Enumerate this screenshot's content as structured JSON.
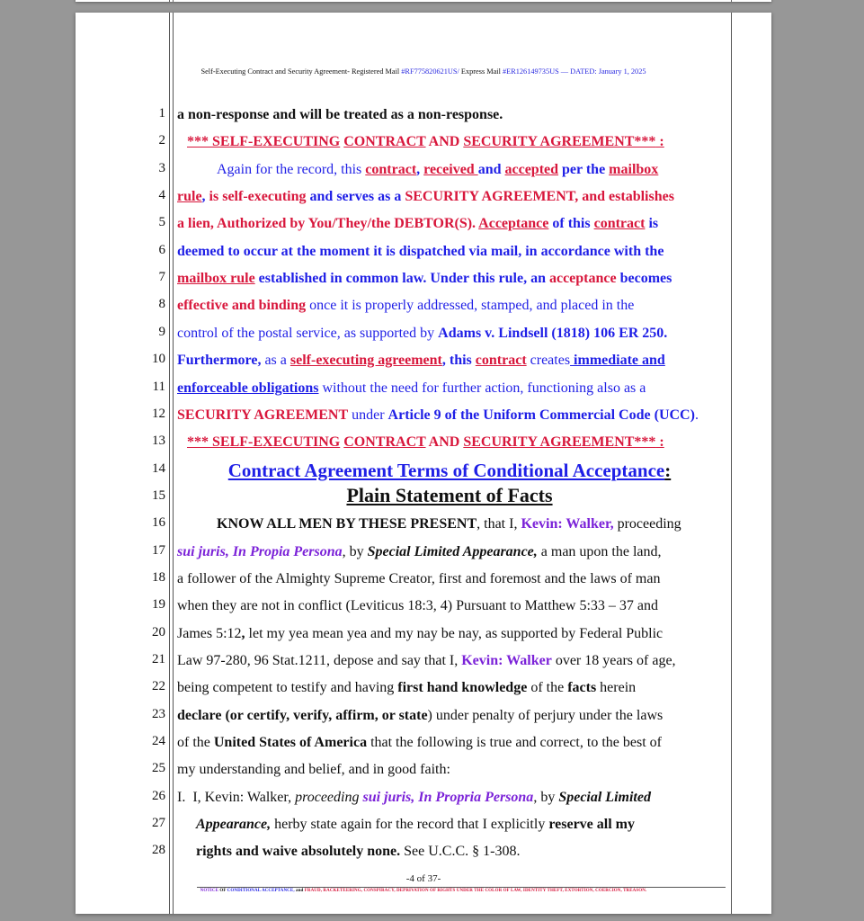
{
  "header": {
    "prefix": "Self-Executing Contract and Security Agreement- Registered Mail ",
    "registered_no": "#RF775820621US/",
    "express_label": " Express Mail ",
    "express_no": "#ER126149735US",
    "dated": "  — DATED: January 1, 2025"
  },
  "lines": {
    "l1": "a non-response and will be treated as a non-response.",
    "l2": {
      "a": "*** SELF-EXECUTING",
      "b": " ",
      "c": "CONTRACT",
      "d": " AND ",
      "e": "SECURITY AGREEMENT***",
      "f": " :"
    },
    "l3": {
      "a": "Again for the record, this ",
      "b": "contract",
      "c": ", ",
      "d": "received ",
      "e": "and ",
      "f": "accepted",
      "g": " per the ",
      "h": "mailbox"
    },
    "l4": {
      "a": "rule",
      "b": ", ",
      "c": "is self-executing",
      "d": " and serves as a ",
      "e": "SECURITY AGREEMENT, and establishes"
    },
    "l5": {
      "a": "a lien, Authorized by You/They/the DEBTOR(S). ",
      "b": "Acceptance",
      "c": " of this ",
      "d": "contract",
      "e": " is"
    },
    "l6": "deemed to occur at the moment it is dispatched via mail, in accordance with the",
    "l7": {
      "a": "mailbox rule",
      "b": " established in common law. Under this rule, an ",
      "c": "acceptance",
      "d": " becomes"
    },
    "l8": {
      "a": "effective and binding",
      "b": " once it is properly addressed, stamped, and placed in the"
    },
    "l9": {
      "a": "control of the postal service, as supported by ",
      "b": "Adams v. Lindsell (1818) 106 ER 250."
    },
    "l10": {
      "a": "Furthermore,",
      "b": " as a ",
      "c": "self-executing agreement",
      "d": ", this ",
      "e": "contract",
      "f": " creates",
      "g": " immediate and"
    },
    "l11": {
      "a": "enforceable obligations",
      "b": " without the need for further action, functioning also as a"
    },
    "l12": {
      "a": "SECURITY AGREEMENT",
      "b": " under ",
      "c": "Article 9 of the Uniform Commercial Code (UCC)",
      "d": "."
    },
    "l13": {
      "a": "*** SELF-EXECUTING",
      "b": " ",
      "c": "CONTRACT",
      "d": " AND ",
      "e": "SECURITY AGREEMENT***",
      "f": " :"
    },
    "l14": {
      "a": "Contract Agreement Terms of Conditional Acceptance",
      "b": ":"
    },
    "l15": "Plain Statement of Facts",
    "l16": {
      "a": "KNOW ALL MEN BY THESE PRESENT",
      "b": ", that I, ",
      "c": "Kevin: Walker,",
      "d": " proceeding"
    },
    "l17": {
      "a": "sui juris, In Propia Persona",
      "b": ", by ",
      "c": "Special Limited Appearance,",
      "d": " a man upon the land,"
    },
    "l18": "a follower of the Almighty Supreme Creator, first and foremost and the laws of man",
    "l19": "when they are not in conflict (Leviticus 18:3, 4) Pursuant to Matthew 5:33 – 37 and",
    "l20": {
      "a": "James 5:12",
      "b": ",",
      "c": " let my yea mean yea and my nay be nay, as supported by Federal Public"
    },
    "l21": {
      "a": "Law 97-280, 96 Stat.1211, depose and say that I, ",
      "b": "Kevin: Walker",
      "c": " over 18 years of age,"
    },
    "l22": {
      "a": "being competent to testify and having ",
      "b": "first hand knowledge",
      "c": " of the ",
      "d": "facts",
      "e": " herein"
    },
    "l23": {
      "a": "declare (or certify, verify, affirm, or state",
      "b": ") under penalty of perjury under the laws"
    },
    "l24": {
      "a": "of the ",
      "b": "United States of America",
      "c": " that the following is true and correct, to the best of"
    },
    "l25": "my understanding and belief, and in good faith:",
    "l26": {
      "num": "I.",
      "a": "I, Kevin: Walker, ",
      "b": "proceeding",
      "c": " ",
      "d": "sui juris, In Propria Persona",
      "e": ", by ",
      "f": "Special Limited"
    },
    "l27": {
      "a": "Appearance,",
      "b": " herby state again for the record that I explicitly ",
      "c": "reserve all my"
    },
    "l28": {
      "a": "rights and waive absolutely none.",
      "b": " See U.C.C. § 1-308."
    }
  },
  "line_numbers": [
    "1",
    "2",
    "3",
    "4",
    "5",
    "6",
    "7",
    "8",
    "9",
    "10",
    "11",
    "12",
    "13",
    "14",
    "15",
    "16",
    "17",
    "18",
    "19",
    "20",
    "21",
    "22",
    "23",
    "24",
    "25",
    "26",
    "27",
    "28"
  ],
  "footer": {
    "page": "-4 of 37-",
    "notice_a": "NOTICE",
    "notice_b": " OF ",
    "notice_c": "CONDITIONAL ACCEPTANCE,",
    "notice_d": " and ",
    "notice_e": "FRAUD, RACKETEERING, CONSPIRACY, DEPRIVATION OF RIGHTS UNDER THE COLOR OF LAW, IDENTITY THEFT, EXTORTION, COERCION, TREASON."
  },
  "colors": {
    "red": "#d8173c",
    "blue": "#1f1fe6",
    "purple": "#7b22d8",
    "background": "#979797"
  }
}
